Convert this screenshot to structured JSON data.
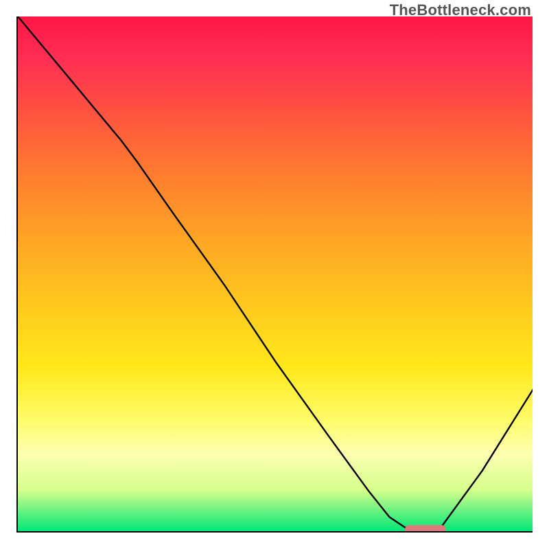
{
  "watermark": "TheBottleneck.com",
  "chart_data": {
    "type": "line",
    "title": "",
    "xlabel": "",
    "ylabel": "",
    "xlim": [
      0,
      100
    ],
    "ylim": [
      0,
      100
    ],
    "gradient_direction": "vertical",
    "gradient_meaning": "top_red_bad_to_bottom_green_good",
    "series": [
      {
        "name": "bottleneck-curve",
        "x": [
          0,
          5,
          10,
          15,
          20,
          23,
          30,
          40,
          50,
          60,
          68,
          72,
          75,
          80,
          82,
          90,
          100
        ],
        "y": [
          100,
          94,
          88,
          82,
          76,
          72,
          62,
          48,
          33,
          19,
          8,
          3,
          1,
          0,
          1,
          12,
          28
        ]
      }
    ],
    "marker": {
      "name": "optimal-range-marker",
      "x_range": [
        75,
        83
      ],
      "y": 0.5,
      "color": "#d97b7b"
    }
  }
}
